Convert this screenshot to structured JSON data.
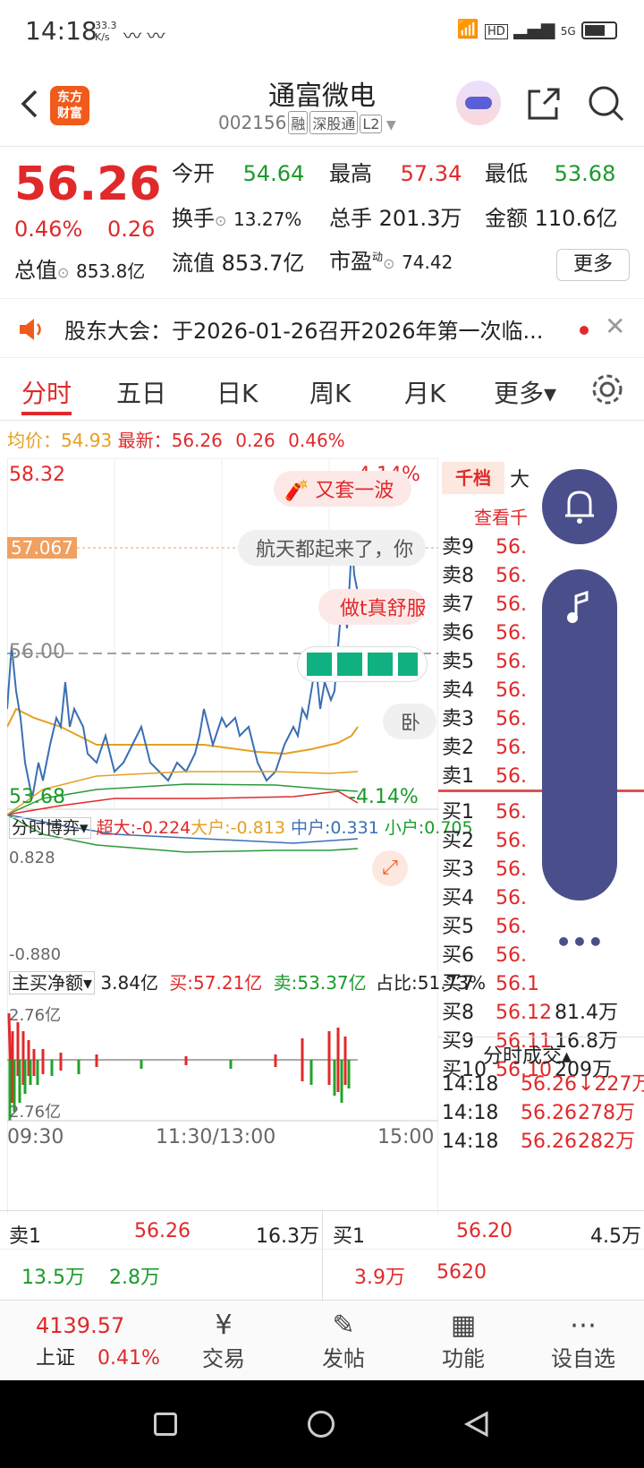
{
  "status": {
    "time": "14:18",
    "speed": "33.3\nK/s",
    "icons": "HD 5G"
  },
  "header": {
    "title": "通富微电",
    "code": "002156",
    "tags": [
      "融",
      "深股通",
      "L2"
    ],
    "logo": "东方\n财富"
  },
  "quote": {
    "price": "56.26",
    "change_pct": "0.46%",
    "change": "0.26",
    "open_label": "今开",
    "open": "54.64",
    "high_label": "最高",
    "high": "57.34",
    "low_label": "最低",
    "low": "53.68",
    "turnover_label": "换手",
    "turnover": "13.27%",
    "volume_label": "总手",
    "volume": "201.3万",
    "amount_label": "金额",
    "amount": "110.6亿",
    "mktcap_label": "总值",
    "mktcap": "853.8亿",
    "float_label": "流值",
    "float": "853.7亿",
    "pe_label": "市盈",
    "pe_sup": "动",
    "pe": "74.42",
    "more": "更多"
  },
  "notice": {
    "text": "股东大会：于2026-01-26召开2026年第一次临..."
  },
  "tabs": [
    "分时",
    "五日",
    "日K",
    "周K",
    "月K",
    "更多▾"
  ],
  "info": {
    "avg_label": "均价：",
    "avg": "54.93",
    "latest_label": "最新：",
    "latest": "56.26",
    "chg": "0.26",
    "pct": "0.46%"
  },
  "chart": {
    "ymax": "58.32",
    "ymin": "53.68",
    "pmax": "4.14%",
    "pmin": "-4.14%",
    "mark": "57.067",
    "mid": "56.00",
    "bubble1": "又套一波",
    "bubble2": "航天都起来了，你",
    "bubble3": "做t真舒服",
    "bubble4": "卧",
    "bobo_label": "分时博弈",
    "super": "超大:-0.224",
    "big": "大户:-0.813",
    "mid_label": "中户:0.331",
    "small": "小户:0.705",
    "bobo_max": "0.828",
    "bobo_min": "-0.880",
    "net_label": "主买净额",
    "net": "3.84亿",
    "buy": "买:57.21亿",
    "sell": "卖:53.37亿",
    "ratio": "占比:51.73%",
    "vol_max": "2.76亿",
    "vol_min": "2.76亿",
    "t1": "09:30",
    "t2": "11:30/13:00",
    "t3": "15:00"
  },
  "book": {
    "tab1": "千档",
    "tab2": "大",
    "view": "查看千",
    "asks": [
      {
        "label": "卖9",
        "price": "56."
      },
      {
        "label": "卖8",
        "price": "56."
      },
      {
        "label": "卖7",
        "price": "56."
      },
      {
        "label": "卖6",
        "price": "56."
      },
      {
        "label": "卖5",
        "price": "56."
      },
      {
        "label": "卖4",
        "price": "56."
      },
      {
        "label": "卖3",
        "price": "56."
      },
      {
        "label": "卖2",
        "price": "56."
      },
      {
        "label": "卖1",
        "price": "56."
      }
    ],
    "bids": [
      {
        "label": "买1",
        "price": "56.",
        "vol": ""
      },
      {
        "label": "买2",
        "price": "56.",
        "vol": ""
      },
      {
        "label": "买3",
        "price": "56.",
        "vol": ""
      },
      {
        "label": "买4",
        "price": "56.",
        "vol": ""
      },
      {
        "label": "买5",
        "price": "56.",
        "vol": ""
      },
      {
        "label": "买6",
        "price": "56.",
        "vol": ""
      },
      {
        "label": "买7",
        "price": "56.1",
        "vol": ""
      },
      {
        "label": "买8",
        "price": "56.12",
        "vol": "81.4万"
      },
      {
        "label": "买9",
        "price": "56.11",
        "vol": "16.8万"
      },
      {
        "label": "买10",
        "price": "56.10",
        "vol": "209万"
      }
    ],
    "trades_title": "分时成交▴",
    "trades": [
      {
        "time": "14:18",
        "price": "56.26",
        "vol": "↓227万"
      },
      {
        "time": "14:18",
        "price": "56.26",
        "vol": "278万"
      },
      {
        "time": "14:18",
        "price": "56.26",
        "vol": "282万"
      }
    ]
  },
  "bottomquote": {
    "s1_label": "卖1",
    "s1_price": "56.26",
    "s1_vol": "16.3万",
    "b1_label": "买1",
    "b1_price": "56.20",
    "b1_vol": "4.5万",
    "r2a": "13.5万",
    "r2b": "2.8万",
    "r2c": "3.9万",
    "r2d": "5620"
  },
  "nav": {
    "index_value": "4139.57",
    "index_name": "上证",
    "index_pct": "0.41%",
    "trade": "交易",
    "post": "发帖",
    "func": "功能",
    "watch": "设自选"
  }
}
